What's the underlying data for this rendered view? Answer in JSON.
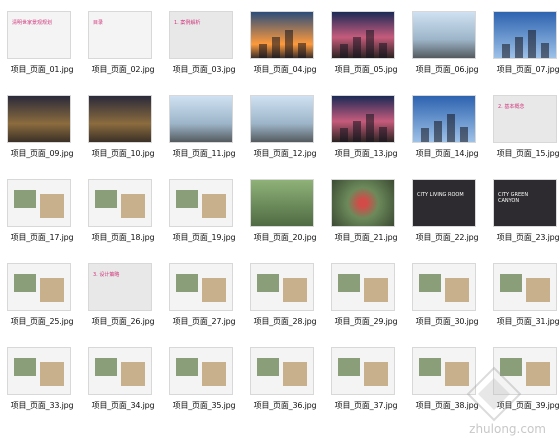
{
  "items": [
    {
      "caption": "项目_页面_01.jpg",
      "style": "white",
      "text": "清明世家景观规划"
    },
    {
      "caption": "项目_页面_02.jpg",
      "style": "white",
      "text": "目录"
    },
    {
      "caption": "项目_页面_03.jpg",
      "style": "grey",
      "text": "1. 案例解析"
    },
    {
      "caption": "项目_页面_04.jpg",
      "style": "city",
      "text": ""
    },
    {
      "caption": "项目_页面_05.jpg",
      "style": "dusk",
      "text": ""
    },
    {
      "caption": "项目_页面_06.jpg",
      "style": "day",
      "text": ""
    },
    {
      "caption": "项目_页面_07.jpg",
      "style": "tower",
      "text": ""
    },
    {
      "caption": "项目_页面_09.jpg",
      "style": "mall",
      "text": ""
    },
    {
      "caption": "项目_页面_10.jpg",
      "style": "mall",
      "text": ""
    },
    {
      "caption": "项目_页面_11.jpg",
      "style": "day",
      "text": ""
    },
    {
      "caption": "项目_页面_12.jpg",
      "style": "day",
      "text": ""
    },
    {
      "caption": "项目_页面_13.jpg",
      "style": "dusk",
      "text": ""
    },
    {
      "caption": "项目_页面_14.jpg",
      "style": "tower",
      "text": ""
    },
    {
      "caption": "项目_页面_15.jpg",
      "style": "grey",
      "text": "2. 基本概念"
    },
    {
      "caption": "项目_页面_17.jpg",
      "style": "white",
      "text": ""
    },
    {
      "caption": "项目_页面_18.jpg",
      "style": "white",
      "text": ""
    },
    {
      "caption": "项目_页面_19.jpg",
      "style": "white",
      "text": ""
    },
    {
      "caption": "项目_页面_20.jpg",
      "style": "green",
      "text": ""
    },
    {
      "caption": "项目_页面_21.jpg",
      "style": "map",
      "text": ""
    },
    {
      "caption": "项目_页面_22.jpg",
      "style": "dark",
      "text": "CITY LIVING ROOM"
    },
    {
      "caption": "项目_页面_23.jpg",
      "style": "dark",
      "text": "CITY GREEN CANYON"
    },
    {
      "caption": "项目_页面_25.jpg",
      "style": "white",
      "text": ""
    },
    {
      "caption": "项目_页面_26.jpg",
      "style": "grey",
      "text": "3. 设计策略"
    },
    {
      "caption": "项目_页面_27.jpg",
      "style": "white",
      "text": ""
    },
    {
      "caption": "项目_页面_28.jpg",
      "style": "white",
      "text": ""
    },
    {
      "caption": "项目_页面_29.jpg",
      "style": "white",
      "text": ""
    },
    {
      "caption": "项目_页面_30.jpg",
      "style": "white",
      "text": ""
    },
    {
      "caption": "项目_页面_31.jpg",
      "style": "white",
      "text": ""
    },
    {
      "caption": "项目_页面_33.jpg",
      "style": "white",
      "text": ""
    },
    {
      "caption": "项目_页面_34.jpg",
      "style": "white",
      "text": ""
    },
    {
      "caption": "项目_页面_35.jpg",
      "style": "white",
      "text": ""
    },
    {
      "caption": "项目_页面_36.jpg",
      "style": "white",
      "text": ""
    },
    {
      "caption": "项目_页面_37.jpg",
      "style": "white",
      "text": ""
    },
    {
      "caption": "项目_页面_38.jpg",
      "style": "white",
      "text": ""
    },
    {
      "caption": "项目_页面_39.jpg",
      "style": "white",
      "text": ""
    }
  ],
  "watermark": "zhulong.com"
}
